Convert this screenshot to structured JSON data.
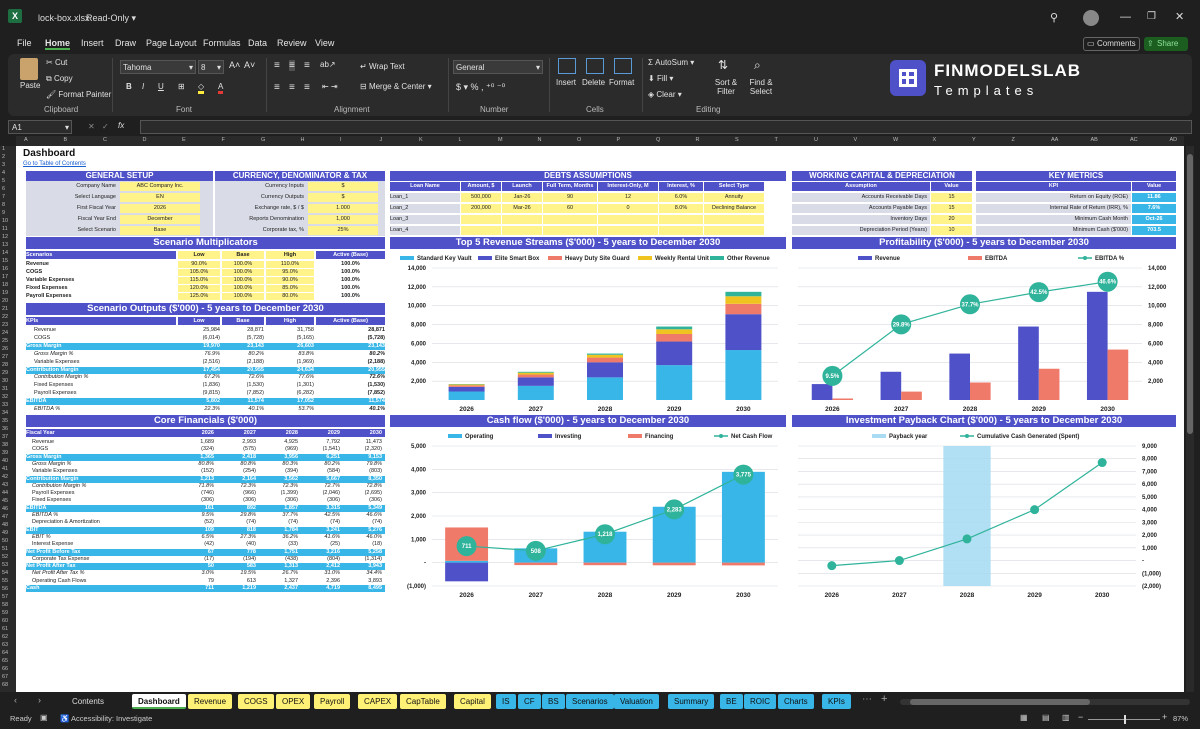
{
  "window": {
    "file": "lock-box.xlsx",
    "mode": "Read-Only"
  },
  "menu": [
    "File",
    "Home",
    "Insert",
    "Draw",
    "Page Layout",
    "Formulas",
    "Data",
    "Review",
    "View"
  ],
  "top_buttons": {
    "comments": "Comments",
    "share": "Share"
  },
  "ribbon": {
    "paste": "Paste",
    "cut": "Cut",
    "copy": "Copy",
    "format_painter": "Format Painter",
    "clipboard": "Clipboard",
    "font_name": "Tahoma",
    "font_size": "8",
    "font": "Font",
    "wrap_text": "Wrap Text",
    "merge": "Merge & Center",
    "alignment": "Alignment",
    "number_format": "General",
    "number": "Number",
    "insert": "Insert",
    "delete": "Delete",
    "format": "Format",
    "cells": "Cells",
    "autosum": "AutoSum",
    "fill": "Fill",
    "clear": "Clear",
    "sort": "Sort & Filter",
    "find": "Find & Select",
    "editing": "Editing",
    "logo_main": "FINMODELSLAB",
    "logo_sub": "Templates"
  },
  "formula_bar": {
    "name_box": "A1",
    "fx": "fx"
  },
  "columns": [
    "A",
    "B",
    "C",
    "D",
    "E",
    "F",
    "G",
    "H",
    "I",
    "J",
    "K",
    "L",
    "M",
    "N",
    "O",
    "P",
    "Q",
    "R",
    "S",
    "T",
    "U",
    "V",
    "W",
    "X",
    "Y",
    "Z",
    "AA",
    "AB",
    "AC",
    "AD"
  ],
  "sheet": {
    "title": "Dashboard",
    "link": "Go to Table of Contents",
    "general_setup": {
      "header": "GENERAL SETUP",
      "rows": [
        [
          "Company Name",
          "ABC Company Inc."
        ],
        [
          "Select Language",
          "EN"
        ],
        [
          "First Fiscal Year",
          "2026"
        ],
        [
          "Fiscal Year End",
          "December"
        ],
        [
          "Select Scenario",
          "Base"
        ]
      ]
    },
    "currency": {
      "header": "CURRENCY, DENOMINATOR & TAX",
      "rows": [
        [
          "Currency Inputs",
          "$"
        ],
        [
          "Currency Outputs",
          "$"
        ],
        [
          "Exchange rate, $ / $",
          "1.000"
        ],
        [
          "Reports Denomination",
          "1,000"
        ],
        [
          "Corporate tax, %",
          "25%"
        ]
      ]
    },
    "debts": {
      "header": "DEBTS ASSUMPTIONS",
      "cols": [
        "Loan Name",
        "Amount, $",
        "Launch",
        "Full Term, Months",
        "Interest-Only, M",
        "Interest, %",
        "Select Type"
      ],
      "rows": [
        [
          "Loan_1",
          "500,000",
          "Jan-26",
          "90",
          "12",
          "6.0%",
          "Annuity"
        ],
        [
          "Loan_2",
          "200,000",
          "Mar-26",
          "60",
          "0",
          "8.0%",
          "Declining Balance"
        ],
        [
          "Loan_3",
          "",
          "",
          "",
          "",
          "",
          ""
        ],
        [
          "Loan_4",
          "",
          "",
          "",
          "",
          "",
          ""
        ]
      ]
    },
    "working_capital": {
      "header": "WORKING CAPITAL & DEPRECIATION",
      "cols": [
        "Assumption",
        "Value"
      ],
      "rows": [
        [
          "Accounts Receivable Days",
          "15"
        ],
        [
          "Accounts Payable Days",
          "15"
        ],
        [
          "Inventory Days",
          "20"
        ],
        [
          "Depreciation Period (Years)",
          "10"
        ]
      ]
    },
    "kpis": {
      "header": "KEY METRICS",
      "cols": [
        "KPI",
        "Value"
      ],
      "rows": [
        [
          "Return on Equity (ROE)",
          "11.86"
        ],
        [
          "Internal Rate of Return (IRR), %",
          "7.6%"
        ],
        [
          "Minimum Cash Month",
          "Oct-26"
        ],
        [
          "Minimum Cash ($'000)",
          "703.5"
        ]
      ]
    },
    "scenario_mult": {
      "header": "Scenario Multiplicators",
      "cols": [
        "Scenarios",
        "Low",
        "Base",
        "High",
        "Active (Base)"
      ],
      "rows": [
        [
          "Revenue",
          "90.0%",
          "100.0%",
          "110.0%",
          "100.0%"
        ],
        [
          "COGS",
          "105.0%",
          "100.0%",
          "95.0%",
          "100.0%"
        ],
        [
          "Variable Expenses",
          "115.0%",
          "100.0%",
          "90.0%",
          "100.0%"
        ],
        [
          "Fixed Expenses",
          "120.0%",
          "100.0%",
          "85.0%",
          "100.0%"
        ],
        [
          "Payroll Expenses",
          "125.0%",
          "100.0%",
          "80.0%",
          "100.0%"
        ]
      ]
    },
    "scenario_out": {
      "header": "Scenario Outputs ($'000) - 5 years to December 2030",
      "cols": [
        "KPIs",
        "Low",
        "Base",
        "High",
        "Active (Base)"
      ],
      "rows": [
        [
          "Revenue",
          "25,984",
          "28,871",
          "31,758",
          "28,871",
          "n"
        ],
        [
          "COGS",
          "(6,014)",
          "(5,728)",
          "(5,165)",
          "(5,728)",
          "n"
        ],
        [
          "Gross Margin",
          "19,970",
          "23,143",
          "26,603",
          "23,143",
          "h"
        ],
        [
          "Gross Margin %",
          "76.9%",
          "80.2%",
          "83.8%",
          "80.2%",
          "s"
        ],
        [
          "Variable Expenses",
          "(2,516)",
          "(2,188)",
          "(1,969)",
          "(2,188)",
          "n"
        ],
        [
          "Contribution Margin",
          "17,454",
          "20,955",
          "24,634",
          "20,955",
          "h"
        ],
        [
          "Contribution Margin %",
          "67.2%",
          "72.6%",
          "77.6%",
          "72.6%",
          "s"
        ],
        [
          "Fixed Expenses",
          "(1,836)",
          "(1,530)",
          "(1,301)",
          "(1,530)",
          "n"
        ],
        [
          "Payroll Expenses",
          "(9,815)",
          "(7,852)",
          "(6,282)",
          "(7,852)",
          "n"
        ],
        [
          "EBITDA",
          "5,802",
          "11,574",
          "17,052",
          "11,574",
          "h"
        ],
        [
          "EBITDA %",
          "22.3%",
          "40.1%",
          "53.7%",
          "40.1%",
          "s"
        ]
      ]
    },
    "core": {
      "header": "Core Financials ($'000)",
      "cols": [
        "Fiscal Year",
        "2026",
        "2027",
        "2028",
        "2029",
        "2030"
      ],
      "rows": [
        [
          "Revenue",
          "1,689",
          "2,993",
          "4,925",
          "7,792",
          "11,473",
          "n"
        ],
        [
          "COGS",
          "(324)",
          "(575)",
          "(969)",
          "(1,541)",
          "(2,320)",
          "n"
        ],
        [
          "Gross Margin",
          "1,365",
          "2,418",
          "3,956",
          "6,251",
          "9,153",
          "h"
        ],
        [
          "Gross Margin %",
          "80.8%",
          "80.8%",
          "80.3%",
          "80.2%",
          "79.8%",
          "s"
        ],
        [
          "Variable Expenses",
          "(152)",
          "(254)",
          "(394)",
          "(584)",
          "(803)",
          "n"
        ],
        [
          "Contribution Margin",
          "1,213",
          "2,164",
          "3,562",
          "5,667",
          "8,350",
          "h"
        ],
        [
          "Contribution Margin %",
          "71.8%",
          "72.3%",
          "72.3%",
          "72.7%",
          "72.8%",
          "s"
        ],
        [
          "Payroll Expenses",
          "(746)",
          "(966)",
          "(1,399)",
          "(2,046)",
          "(2,695)",
          "n"
        ],
        [
          "Fixed Expenses",
          "(306)",
          "(306)",
          "(306)",
          "(306)",
          "(306)",
          "n"
        ],
        [
          "EBITDA",
          "161",
          "892",
          "1,857",
          "3,315",
          "5,349",
          "h"
        ],
        [
          "EBITDA %",
          "9.5%",
          "29.8%",
          "37.7%",
          "42.5%",
          "46.6%",
          "s"
        ],
        [
          "Depreciation & Amortization",
          "(52)",
          "(74)",
          "(74)",
          "(74)",
          "(74)",
          "n"
        ],
        [
          "EBIT",
          "109",
          "818",
          "1,784",
          "3,241",
          "5,276",
          "h"
        ],
        [
          "EBIT %",
          "6.5%",
          "27.3%",
          "36.2%",
          "41.6%",
          "46.0%",
          "s"
        ],
        [
          "Interest Expense",
          "(42)",
          "(40)",
          "(33)",
          "(25)",
          "(18)",
          "n"
        ],
        [
          "Net Profit Before Tax",
          "67",
          "778",
          "1,751",
          "3,216",
          "5,258",
          "h"
        ],
        [
          "Corporate Tax Expense",
          "(17)",
          "(194)",
          "(438)",
          "(804)",
          "(1,314)",
          "n"
        ],
        [
          "Net Profit After Tax",
          "50",
          "583",
          "1,313",
          "2,412",
          "3,943",
          "h"
        ],
        [
          "Net Profit After Tax %",
          "3.0%",
          "19.5%",
          "26.7%",
          "31.0%",
          "34.4%",
          "s"
        ],
        [
          "Operating Cash Flows",
          "79",
          "613",
          "1,327",
          "2,396",
          "3,893",
          "n"
        ],
        [
          "Cash",
          "711",
          "1,219",
          "2,437",
          "4,719",
          "8,495",
          "h"
        ]
      ]
    }
  },
  "charts": {
    "revenue": {
      "title": "Top 5 Revenue Streams ($'000) - 5 years to December 2030"
    },
    "profit": {
      "title": "Profitability ($'000) - 5 years to December 2030"
    },
    "cashflow": {
      "title": "Cash flow ($'000) - 5 years to December 2030"
    },
    "payback": {
      "title": "Investment Payback Chart ($'000) - 5 years to December 2030"
    }
  },
  "chart_data": [
    {
      "type": "bar",
      "stacked": true,
      "title": "Top 5 Revenue Streams ($'000) - 5 years to December 2030",
      "categories": [
        "2026",
        "2027",
        "2028",
        "2029",
        "2030"
      ],
      "ylim": [
        0,
        14000
      ],
      "yticks": [
        2000,
        4000,
        6000,
        8000,
        10000,
        12000,
        14000
      ],
      "tick_labels": [
        "2,000",
        "4,000",
        "6,000",
        "8,000",
        "10,000",
        "12,000",
        "14,000"
      ],
      "series": [
        {
          "name": "Standard Key Vault",
          "color": "#38b6e8",
          "values": [
            900,
            1500,
            2400,
            3700,
            5300
          ]
        },
        {
          "name": "Elite Smart Box",
          "color": "#4f51c9",
          "values": [
            500,
            900,
            1600,
            2500,
            3800
          ]
        },
        {
          "name": "Heavy Duty Site Guard",
          "color": "#f07a6a",
          "values": [
            150,
            300,
            500,
            800,
            1100
          ]
        },
        {
          "name": "Weekly Rental Unit",
          "color": "#f0c420",
          "values": [
            100,
            200,
            300,
            500,
            800
          ]
        },
        {
          "name": "Other Revenue",
          "color": "#2fb39a",
          "values": [
            40,
            90,
            125,
            292,
            473
          ]
        }
      ]
    },
    {
      "type": "bar",
      "title": "Profitability ($'000) - 5 years to December 2030",
      "categories": [
        "2026",
        "2027",
        "2028",
        "2029",
        "2030"
      ],
      "ylim": [
        0,
        14000
      ],
      "yticks": [
        2000,
        4000,
        6000,
        8000,
        10000,
        12000,
        14000
      ],
      "tick_labels": [
        "2,000",
        "4,000",
        "6,000",
        "8,000",
        "10,000",
        "12,000",
        "14,000"
      ],
      "series": [
        {
          "name": "Revenue",
          "color": "#4f51c9",
          "values": [
            1689,
            2993,
            4925,
            7792,
            11473
          ]
        },
        {
          "name": "EBITDA",
          "color": "#f07a6a",
          "values": [
            161,
            892,
            1857,
            3315,
            5349
          ]
        },
        {
          "name": "EBITDA %",
          "color": "#2fb39a",
          "values": [
            9.5,
            29.8,
            37.7,
            42.5,
            46.6
          ],
          "labels": [
            "9.5%",
            "29.8%",
            "37.7%",
            "42.5%",
            "46.6%"
          ]
        }
      ]
    },
    {
      "type": "bar",
      "title": "Cash flow ($'000) - 5 years to December 2030",
      "categories": [
        "2026",
        "2027",
        "2028",
        "2029",
        "2030"
      ],
      "ylim": [
        -1000,
        5000
      ],
      "yticks": [
        -1000,
        0,
        1000,
        2000,
        3000,
        4000,
        5000
      ],
      "tick_labels": [
        "(1,000)",
        "-",
        "1,000",
        "2,000",
        "3,000",
        "4,000",
        "5,000"
      ],
      "series": [
        {
          "name": "Operating",
          "color": "#38b6e8",
          "values": [
            79,
            613,
            1327,
            2396,
            3893
          ]
        },
        {
          "name": "Investing",
          "color": "#4f51c9",
          "values": [
            -800,
            0,
            0,
            0,
            0
          ]
        },
        {
          "name": "Financing",
          "color": "#f07a6a",
          "values": [
            1430,
            -105,
            -109,
            -114,
            -117
          ]
        },
        {
          "name": "Net Cash Flow",
          "color": "#2fb39a",
          "values": [
            711,
            508,
            1218,
            2283,
            3775
          ],
          "labels": [
            "711",
            "508",
            "1,218",
            "2,283",
            "3,775"
          ]
        }
      ]
    },
    {
      "type": "line",
      "title": "Investment Payback Chart ($'000) - 5 years to December 2030",
      "categories": [
        "2026",
        "2027",
        "2028",
        "2029",
        "2030"
      ],
      "ylim": [
        -2000,
        9000
      ],
      "yticks": [
        -2000,
        -1000,
        0,
        1000,
        2000,
        3000,
        4000,
        5000,
        6000,
        7000,
        8000,
        9000
      ],
      "tick_labels": [
        "(2,000)",
        "(1,000)",
        "-",
        "1,000",
        "2,000",
        "3,000",
        "4,000",
        "5,000",
        "6,000",
        "7,000",
        "8,000",
        "9,000"
      ],
      "series": [
        {
          "name": "Payback year",
          "color": "#a9dbf2",
          "values": [
            0,
            0,
            1,
            0,
            0
          ]
        },
        {
          "name": "Cumulative Cash Generated (Spent)",
          "color": "#2fb39a",
          "values": [
            -400,
            0,
            1700,
            4000,
            7700
          ]
        }
      ]
    }
  ],
  "tabs": [
    "Contents",
    "Dashboard",
    "Revenue",
    "COGS",
    "OPEX",
    "Payroll",
    "CAPEX",
    "CapTable",
    "Capital",
    "IS",
    "CF",
    "BS",
    "Scenarios",
    "Valuation",
    "Summary",
    "BE",
    "ROIC",
    "Charts",
    "KPIs"
  ],
  "status": {
    "ready": "Ready",
    "accessibility": "Accessibility: Investigate",
    "zoom": "87%"
  }
}
